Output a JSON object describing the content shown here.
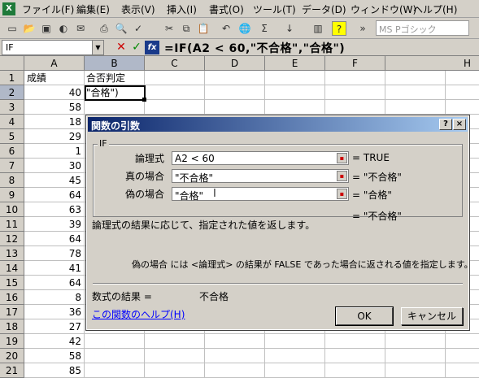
{
  "menu": [
    "ファイル(F)",
    "編集(E)",
    "表示(V)",
    "挿入(I)",
    "書式(O)",
    "ツール(T)",
    "データ(D)",
    "ウィンドウ(W)",
    "ヘルプ(H)"
  ],
  "toolbar": {
    "font_name": "MS Pゴシック"
  },
  "formula_bar": {
    "name_box": "IF",
    "formula": "=IF(A2 < 60,\"不合格\",\"合格\")"
  },
  "columns": [
    "A",
    "B",
    "C",
    "D",
    "E",
    "F",
    "H"
  ],
  "rows": [
    {
      "n": "1",
      "a": "成績",
      "b": "合否判定"
    },
    {
      "n": "2",
      "a": "40",
      "b": "\"合格\")"
    },
    {
      "n": "3",
      "a": "58",
      "b": ""
    },
    {
      "n": "4",
      "a": "18",
      "b": ""
    },
    {
      "n": "5",
      "a": "29",
      "b": ""
    },
    {
      "n": "6",
      "a": "1",
      "b": ""
    },
    {
      "n": "7",
      "a": "30",
      "b": ""
    },
    {
      "n": "8",
      "a": "45",
      "b": ""
    },
    {
      "n": "9",
      "a": "64",
      "b": ""
    },
    {
      "n": "10",
      "a": "63",
      "b": ""
    },
    {
      "n": "11",
      "a": "39",
      "b": ""
    },
    {
      "n": "12",
      "a": "64",
      "b": ""
    },
    {
      "n": "13",
      "a": "78",
      "b": ""
    },
    {
      "n": "14",
      "a": "41",
      "b": ""
    },
    {
      "n": "15",
      "a": "64",
      "b": ""
    },
    {
      "n": "16",
      "a": "8",
      "b": ""
    },
    {
      "n": "17",
      "a": "36",
      "b": ""
    },
    {
      "n": "18",
      "a": "27",
      "b": ""
    },
    {
      "n": "19",
      "a": "42",
      "b": ""
    },
    {
      "n": "20",
      "a": "58",
      "b": ""
    },
    {
      "n": "21",
      "a": "85",
      "b": ""
    }
  ],
  "dialog": {
    "title": "関数の引数",
    "help_btn": "?",
    "close_btn": "×",
    "group": "IF",
    "args": [
      {
        "label": "論理式",
        "value": "A2 < 60",
        "result": "= TRUE"
      },
      {
        "label": "真の場合",
        "value": "\"不合格\"",
        "result": "= \"不合格\""
      },
      {
        "label": "偽の場合",
        "value": "\"合格\"",
        "result": "= \"合格\""
      }
    ],
    "overall_result": "= \"不合格\"",
    "description": "論理式の結果に応じて、指定された値を返します。",
    "arg_help": "偽の場合 には <論理式> の結果が FALSE であった場合に返される値を指定します。",
    "formula_result_label": "数式の結果 =",
    "formula_result_value": "不合格",
    "help_link": "この関数のヘルプ(H)",
    "ok": "OK",
    "cancel": "キャンセル"
  }
}
